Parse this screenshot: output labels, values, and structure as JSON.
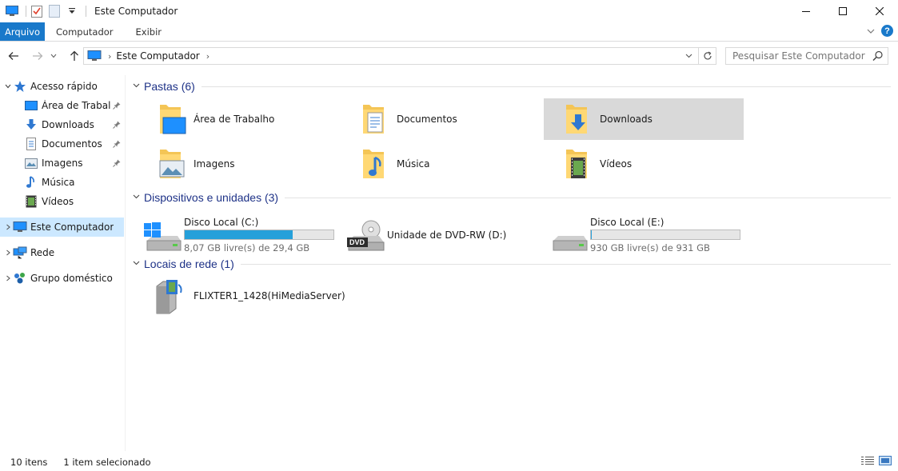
{
  "window": {
    "title": "Este Computador"
  },
  "ribbon": {
    "tabs": [
      {
        "label": "Arquivo"
      },
      {
        "label": "Computador"
      },
      {
        "label": "Exibir"
      }
    ],
    "help_label": "?"
  },
  "address": {
    "path": "Este Computador"
  },
  "search": {
    "placeholder": "Pesquisar Este Computador"
  },
  "sidebar": {
    "items": [
      {
        "label": "Acesso rápido",
        "icon": "star-icon"
      },
      {
        "label": "Área de Trabalho",
        "icon": "desktop-icon",
        "pinned": true
      },
      {
        "label": "Downloads",
        "icon": "download-icon",
        "pinned": true
      },
      {
        "label": "Documentos",
        "icon": "document-icon",
        "pinned": true
      },
      {
        "label": "Imagens",
        "icon": "image-icon",
        "pinned": true
      },
      {
        "label": "Música",
        "icon": "music-icon"
      },
      {
        "label": "Vídeos",
        "icon": "video-icon"
      },
      {
        "label": "Este Computador",
        "icon": "computer-icon",
        "selected": true
      },
      {
        "label": "Rede",
        "icon": "network-icon"
      },
      {
        "label": "Grupo doméstico",
        "icon": "homegroup-icon"
      }
    ]
  },
  "groups": {
    "folders": {
      "title": "Pastas (6)",
      "items": [
        {
          "label": "Área de Trabalho",
          "icon": "desktop-folder-icon"
        },
        {
          "label": "Documentos",
          "icon": "documents-folder-icon"
        },
        {
          "label": "Downloads",
          "icon": "downloads-folder-icon",
          "selected": true
        },
        {
          "label": "Imagens",
          "icon": "pictures-folder-icon"
        },
        {
          "label": "Música",
          "icon": "music-folder-icon"
        },
        {
          "label": "Vídeos",
          "icon": "videos-folder-icon"
        }
      ]
    },
    "devices": {
      "title": "Dispositivos e unidades (3)",
      "items": [
        {
          "label": "Disco Local (C:)",
          "free": "8,07 GB livre(s) de 29,4 GB",
          "used_fraction": 0.726,
          "bar_color": "#26a0da"
        },
        {
          "label": "Unidade de DVD-RW (D:)"
        },
        {
          "label": "Disco Local (E:)",
          "free": "930 GB livre(s) de 931 GB",
          "used_fraction": 0.001,
          "bar_color": "#26a0da"
        }
      ],
      "dvd_badge": "DVD"
    },
    "network": {
      "title": "Locais de rede (1)",
      "items": [
        {
          "label": "FLIXTER1_1428(HiMediaServer)",
          "icon": "media-server-icon"
        }
      ]
    }
  },
  "status": {
    "count": "10 itens",
    "selection": "1 item selecionado"
  },
  "colors": {
    "accent": "#1979ca",
    "selection": "#cce8ff",
    "group_title": "#1e3287",
    "drive_bar": "#26a0da"
  }
}
